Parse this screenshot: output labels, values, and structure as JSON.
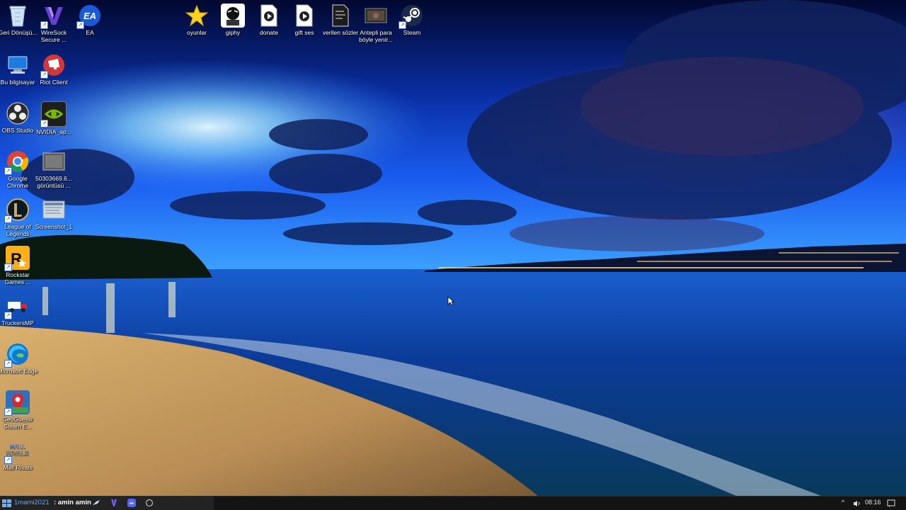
{
  "desktop": {
    "icons": [
      {
        "id": "geri-donusum",
        "label": "Geri Dönüşü...",
        "icon": "recycle-bin-icon"
      },
      {
        "id": "wiresock",
        "label": "WireSock Secure ...",
        "icon": "wiresock-icon"
      },
      {
        "id": "ea",
        "label": "EA",
        "icon": "ea-icon"
      },
      {
        "id": "oyunlar",
        "label": "oyunlar",
        "icon": "star-icon"
      },
      {
        "id": "giphy",
        "label": "giphy",
        "icon": "giphy-icon"
      },
      {
        "id": "donate",
        "label": "donate",
        "icon": "video-file-icon"
      },
      {
        "id": "gift-ses",
        "label": "gift ses",
        "icon": "video-file-icon"
      },
      {
        "id": "verilen-sozler",
        "label": "verilen sözler",
        "icon": "document-icon"
      },
      {
        "id": "antepli",
        "label": "Antepli para böyle yenir...",
        "icon": "video-thumbnail-icon"
      },
      {
        "id": "steam",
        "label": "Steam",
        "icon": "steam-icon"
      },
      {
        "id": "bu-bilgisayar",
        "label": "Bu bilgisayar",
        "icon": "computer-icon"
      },
      {
        "id": "riot-client",
        "label": "Riot Client",
        "icon": "riot-icon"
      },
      {
        "id": "obs-studio",
        "label": "OBS Studio",
        "icon": "obs-icon"
      },
      {
        "id": "nvidia",
        "label": "NVIDIA_ap...",
        "icon": "nvidia-icon"
      },
      {
        "id": "google-chrome",
        "label": "Google Chrome",
        "icon": "chrome-icon"
      },
      {
        "id": "screenshot-file",
        "label": "50303669.6... görüntüsü ...",
        "icon": "image-file-icon"
      },
      {
        "id": "league-of-legends",
        "label": "League of Legends",
        "icon": "league-icon"
      },
      {
        "id": "screenshot-1",
        "label": "Screenshot_1",
        "icon": "image-file-icon"
      },
      {
        "id": "rockstar",
        "label": "Rockstar Games ...",
        "icon": "rockstar-icon"
      },
      {
        "id": "truckersmp",
        "label": "TruckersMP",
        "icon": "truckersmp-icon"
      },
      {
        "id": "microsoft-edge",
        "label": "Microsoft Edge",
        "icon": "edge-icon"
      },
      {
        "id": "geoguessr",
        "label": "GeoGuessr Steam E...",
        "icon": "geoguessr-icon"
      },
      {
        "id": "mall-rivals",
        "label": "Mall Rivals",
        "icon": "mall-rivals-icon"
      }
    ]
  },
  "taskbar": {
    "streamer_text": "1mami2021",
    "user_text": ": amin amin",
    "apps": [
      "steam-icon",
      "vpn-icon",
      "discord-icon",
      "circle-icon"
    ],
    "time": "08:16"
  },
  "colors": {
    "taskbar": "#141414",
    "sky_top": "#030a3c",
    "sky_mid": "#0a3cc8",
    "sea": "#0d3f93",
    "sand": "#c8a268"
  }
}
